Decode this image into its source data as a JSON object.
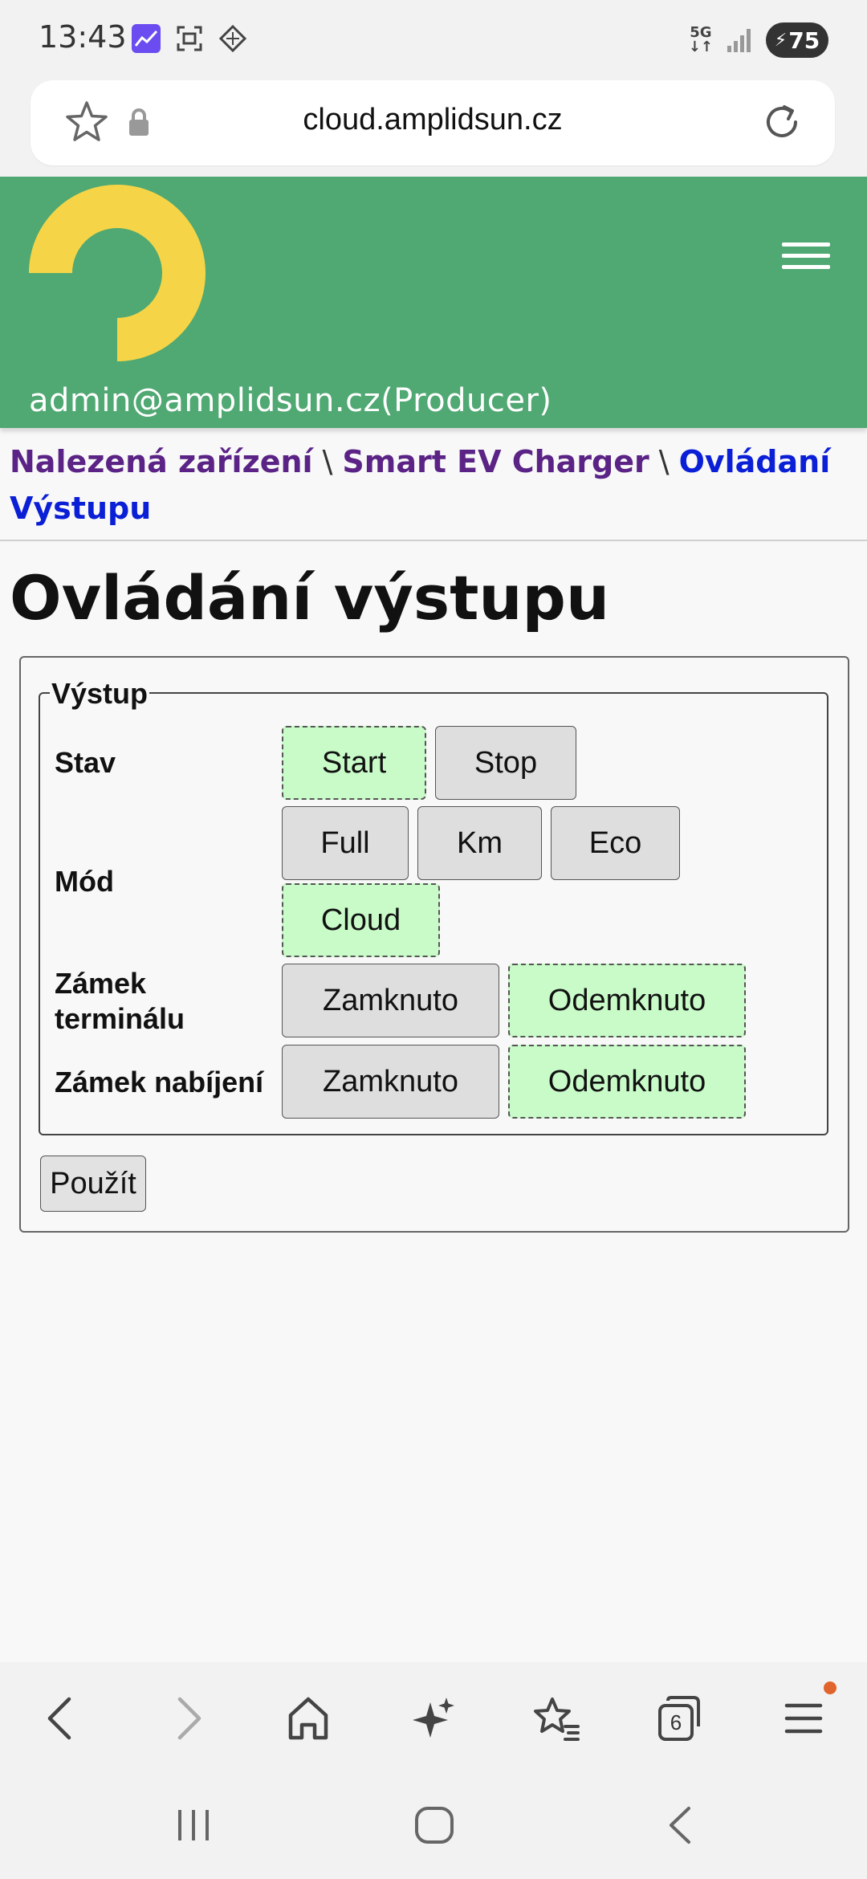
{
  "status_bar": {
    "time": "13:43",
    "network": "5G",
    "battery": "75",
    "icons": [
      "stocks-app-icon",
      "screenshot-icon",
      "grid-app-icon",
      "signal-icon",
      "battery-charging-icon"
    ]
  },
  "browser": {
    "url": "cloud.amplidsun.cz",
    "icons": [
      "star-icon",
      "lock-icon",
      "reload-icon"
    ]
  },
  "header": {
    "user": "admin@amplidsun.cz(Producer)",
    "brand_color": "#50a872",
    "logo_color": "#f5d547"
  },
  "breadcrumb": {
    "items": [
      "Nalezená zařízení",
      "Smart EV Charger",
      "Ovládaní Výstupu"
    ],
    "separator": "\\"
  },
  "page": {
    "title": "Ovládání výstupu"
  },
  "form": {
    "legend": "Výstup",
    "rows": [
      {
        "label": "Stav",
        "options": [
          "Start",
          "Stop"
        ],
        "selected": "Start"
      },
      {
        "label": "Mód",
        "options": [
          "Full",
          "Km",
          "Eco",
          "Cloud"
        ],
        "selected": "Cloud"
      },
      {
        "label": "Zámek terminálu",
        "options": [
          "Zamknuto",
          "Odemknuto"
        ],
        "selected": "Odemknuto"
      },
      {
        "label": "Zámek nabíjení",
        "options": [
          "Zamknuto",
          "Odemknuto"
        ],
        "selected": "Odemknuto"
      }
    ],
    "apply_label": "Použít",
    "active_color": "#c9fbc9",
    "inactive_color": "#dedede"
  },
  "toolbar": {
    "tabs_count": "6",
    "icons": [
      "back-icon",
      "forward-icon",
      "home-icon",
      "sparkle-icon",
      "bookmarks-icon",
      "tabs-icon",
      "menu-icon"
    ]
  },
  "system_nav": {
    "icons": [
      "recents-icon",
      "home-circle-icon",
      "system-back-icon"
    ]
  }
}
